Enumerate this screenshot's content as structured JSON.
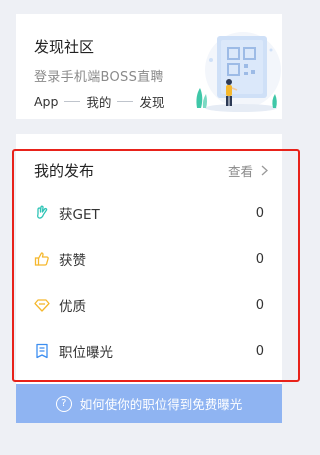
{
  "community": {
    "title": "发现社区",
    "subtitle": "登录手机端BOSS直聘",
    "steps": [
      "App",
      "我的",
      "发现"
    ]
  },
  "publish": {
    "title": "我的发布",
    "view_label": "查看",
    "stats": [
      {
        "label": "获GET",
        "value": "0",
        "icon": "hand-gesture-icon",
        "color": "#2ec4b6"
      },
      {
        "label": "获赞",
        "value": "0",
        "icon": "thumbs-up-icon",
        "color": "#f5b82e"
      },
      {
        "label": "优质",
        "value": "0",
        "icon": "diamond-icon",
        "color": "#f5b82e"
      },
      {
        "label": "职位曝光",
        "value": "0",
        "icon": "document-icon",
        "color": "#3d8ef0"
      }
    ]
  },
  "exposure_button": {
    "label": "如何使你的职位得到免费曝光",
    "icon": "question-circle-icon"
  },
  "colors": {
    "highlight": "#e8221a",
    "button_bg": "#8fb4f2",
    "background": "#eef0f5"
  }
}
